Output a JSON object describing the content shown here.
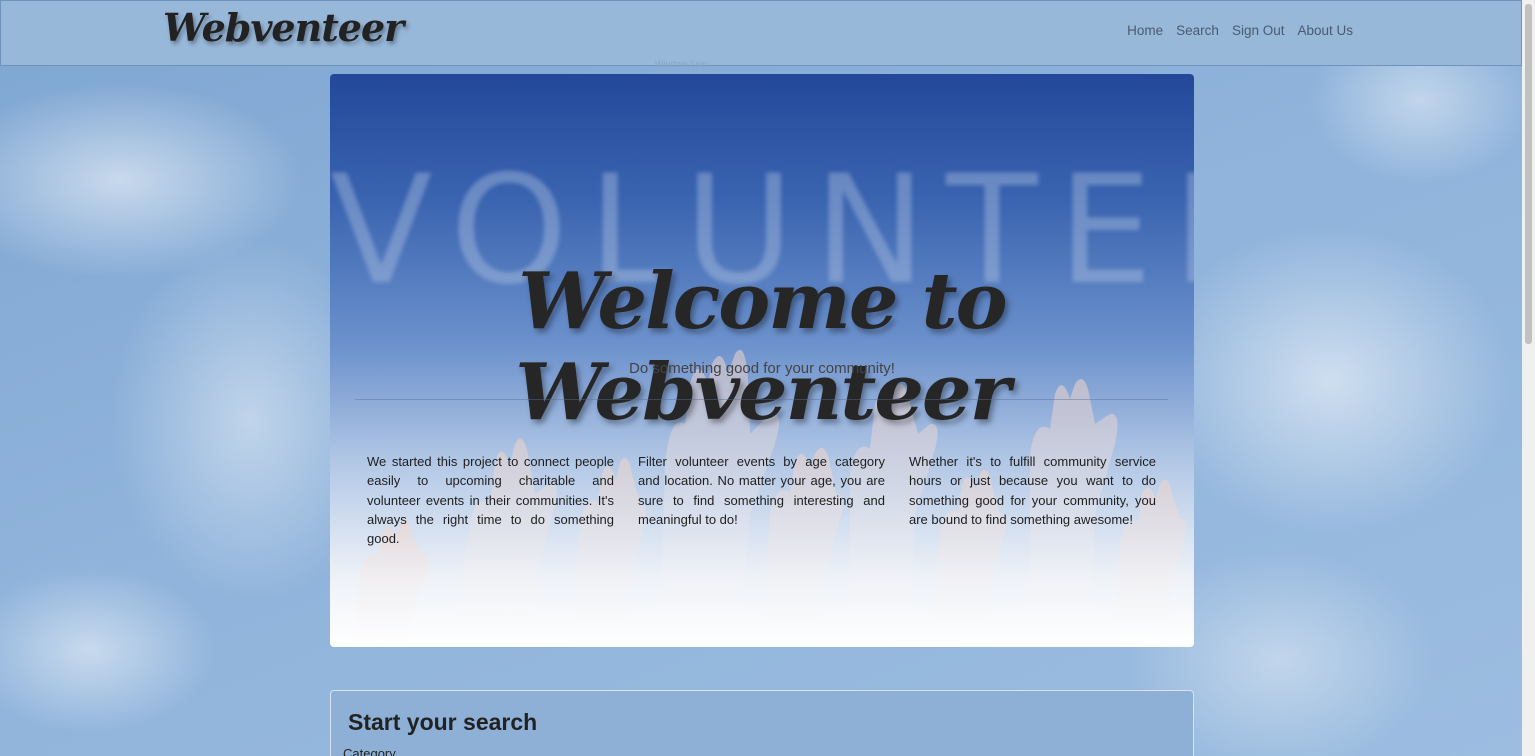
{
  "navbar": {
    "brand": "Webventeer",
    "links": [
      "Home",
      "Search",
      "Sign Out",
      "About Us"
    ]
  },
  "snip_label": "Window Snip",
  "hero": {
    "background_word": "VOLUNTEER",
    "title": "Welcome to Webventeer",
    "subtitle": "Do something good for your community!",
    "columns": [
      "We started this project to connect people easily to upcoming charitable and volunteer events in their communities. It's always the right time to do something good.",
      "Filter volunteer events by age category and location. No matter your age, you are sure to find something interesting and meaningful to do!",
      "Whether it's to fulfill community service hours or just because you want to do something good for your community, you are bound to find something awesome!"
    ]
  },
  "search": {
    "title": "Start your search",
    "category_label": "Category"
  },
  "colors": {
    "navbar": "#98b8da",
    "hero_top": "#23489a",
    "search_panel": "#8eb0d6"
  }
}
